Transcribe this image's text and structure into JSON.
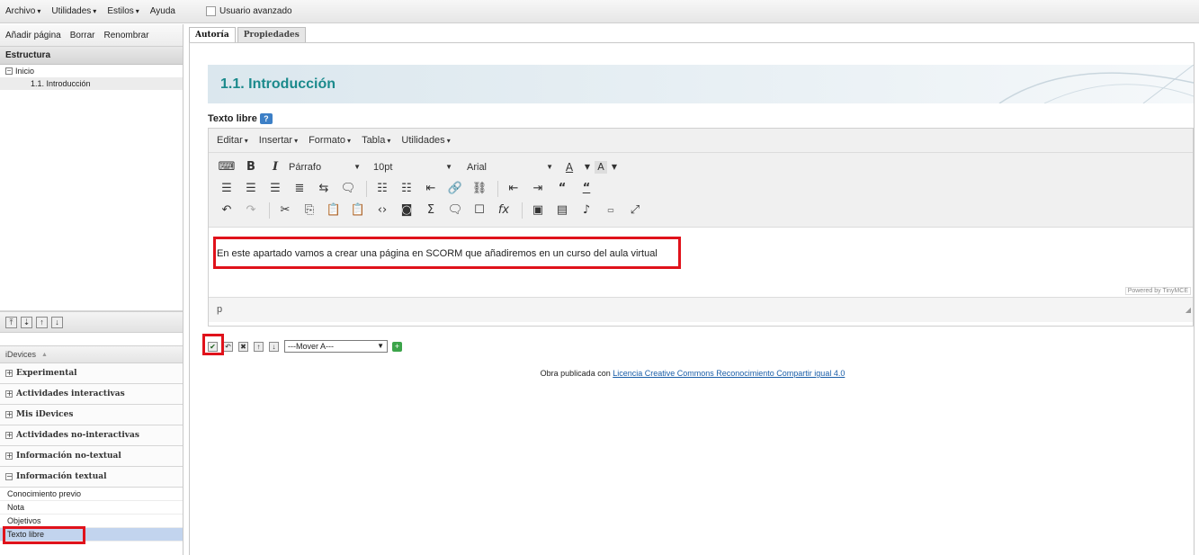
{
  "menubar": {
    "items": [
      {
        "label": "Archivo",
        "caret": "▾"
      },
      {
        "label": "Utilidades",
        "caret": "▾"
      },
      {
        "label": "Estilos",
        "caret": "▾"
      },
      {
        "label": "Ayuda",
        "caret": ""
      }
    ],
    "advanced_label": "Usuario avanzado"
  },
  "page_actions": [
    "Añadir página",
    "Borrar",
    "Renombrar"
  ],
  "structure": {
    "header": "Estructura",
    "root": "Inicio",
    "child": "1.1. Introducción"
  },
  "idevices": {
    "header": "iDevices",
    "header_caret": "▲",
    "categories": [
      "Experimental",
      "Actividades interactivas",
      "Mis iDevices",
      "Actividades no-interactivas",
      "Información no-textual",
      "Información textual"
    ],
    "subitems": [
      "Conocimiento previo",
      "Nota",
      "Objetivos",
      "Texto libre"
    ],
    "selected": "Texto libre"
  },
  "tabs": [
    {
      "label": "Autoría",
      "active": true
    },
    {
      "label": "Propiedades",
      "active": false
    }
  ],
  "page": {
    "title": "1.1. Introducción",
    "block_label": "Texto libre"
  },
  "editor": {
    "menus": [
      "Editar",
      "Insertar",
      "Formato",
      "Tabla",
      "Utilidades"
    ],
    "format_select": "Párrafo",
    "size_select": "10pt",
    "font_select": "Arial",
    "content": "En este apartado vamos a crear una página en SCORM que añadiremos en un curso del aula virtual",
    "powered_by": "Powered by TinyMCE",
    "status_path": "p"
  },
  "actions": {
    "move_select": "---Mover A---"
  },
  "license": {
    "prefix": "Obra publicada con ",
    "link_text": "Licencia Creative Commons Reconocimiento Compartir igual 4.0"
  },
  "colors": {
    "accent_title": "#1b8a8c",
    "highlight": "#e0121b",
    "selected_item": "#c2d4ee",
    "link": "#1a5ea8"
  }
}
